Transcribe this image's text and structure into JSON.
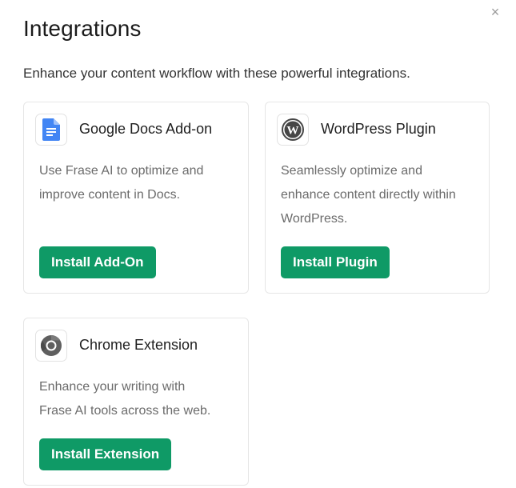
{
  "dialog": {
    "title": "Integrations",
    "subtitle": "Enhance your content workflow with these powerful integrations.",
    "close_symbol": "×"
  },
  "integrations": [
    {
      "name": "Google Docs Add-on",
      "icon": "google-docs-icon",
      "description_lines": [
        "Use Frase AI to optimize and",
        "improve content in Docs."
      ],
      "button_label": "Install Add-On"
    },
    {
      "name": "WordPress Plugin",
      "icon": "wordpress-icon",
      "description_lines": [
        "Seamlessly optimize and",
        "enhance content directly within",
        "WordPress."
      ],
      "button_label": "Install Plugin"
    },
    {
      "name": "Chrome Extension",
      "icon": "chrome-icon",
      "description_lines": [
        "Enhance your writing with",
        "Frase AI tools across the web."
      ],
      "button_label": "Install Extension"
    }
  ],
  "colors": {
    "button_bg": "#0f9a66",
    "button_text": "#ffffff",
    "google_docs_blue": "#4285f4",
    "card_border": "#e6e6e6"
  }
}
